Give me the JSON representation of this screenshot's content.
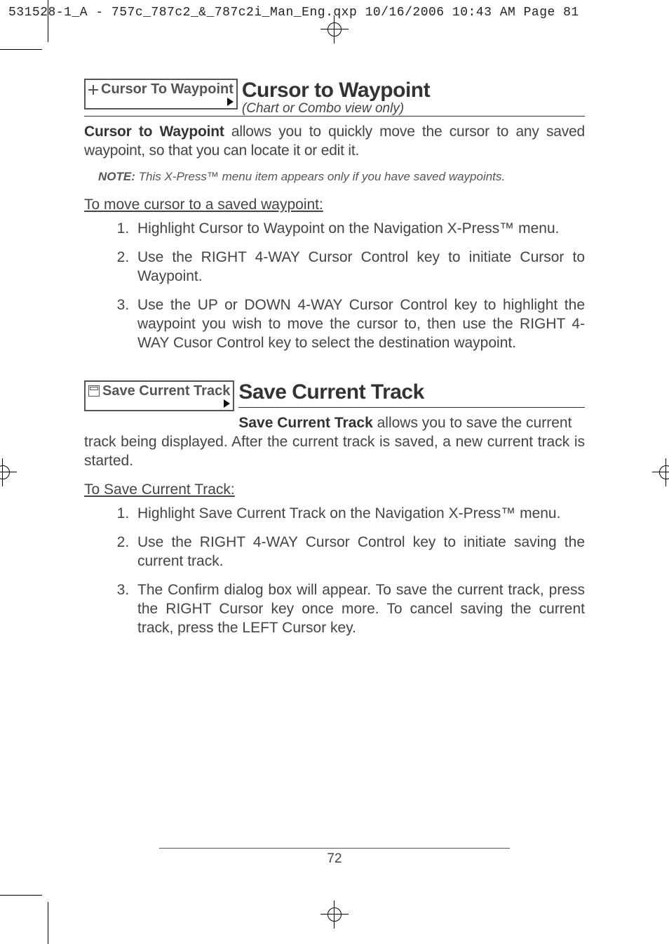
{
  "running_head": "531528-1_A - 757c_787c2_&_787c2i_Man_Eng.qxp  10/16/2006  10:43 AM  Page 81",
  "section1": {
    "menu_label": "Cursor To Waypoint",
    "title": "Cursor to Waypoint",
    "subtitle": "(Chart or Combo view only)",
    "intro_bold": "Cursor to Waypoint",
    "intro_rest": " allows you to quickly move the cursor to any saved waypoint, so that you can locate it or edit it.",
    "note_label": "NOTE:",
    "note_text": " This X-Press™ menu item appears only if you have saved waypoints.",
    "subhead": "To move cursor to a saved waypoint:",
    "steps": [
      "Highlight Cursor to Waypoint on the Navigation X-Press™ menu.",
      "Use the RIGHT 4-WAY Cursor Control key to initiate Cursor to Waypoint.",
      "Use the UP or DOWN 4-WAY Cursor Control key to highlight the waypoint you wish to move the cursor to, then use the RIGHT 4-WAY Cusor Control key to select the destination waypoint."
    ]
  },
  "section2": {
    "menu_label": "Save Current Track",
    "title": "Save Current Track",
    "intro_bold": "Save Current Track",
    "intro_rest": " allows you to save the current track being displayed. After the current track is saved, a new current track is started.",
    "subhead": "To Save Current Track:",
    "steps": [
      "Highlight Save Current Track on the Navigation X-Press™ menu.",
      "Use the RIGHT 4-WAY Cursor Control key to initiate saving the current track.",
      "The Confirm dialog box will appear. To save the current track, press the RIGHT Cursor key once more. To cancel saving the current track, press the LEFT Cursor key."
    ]
  },
  "page_number": "72"
}
